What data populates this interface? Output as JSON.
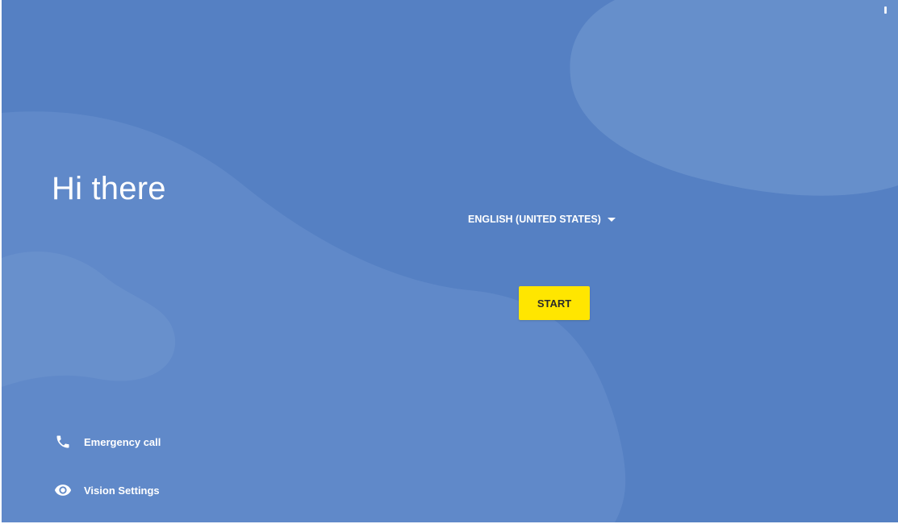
{
  "welcome": {
    "greeting": "Hi there",
    "language_label": "ENGLISH (UNITED STATES)",
    "start_label": "START"
  },
  "bottom_links": {
    "emergency_label": "Emergency call",
    "vision_label": "Vision Settings"
  },
  "icons": {
    "language_dropdown": "chevron-down-icon",
    "emergency": "phone-icon",
    "vision": "eye-icon",
    "status": "battery-icon"
  },
  "colors": {
    "background": "#5580c3",
    "start_button": "#ffe600"
  }
}
